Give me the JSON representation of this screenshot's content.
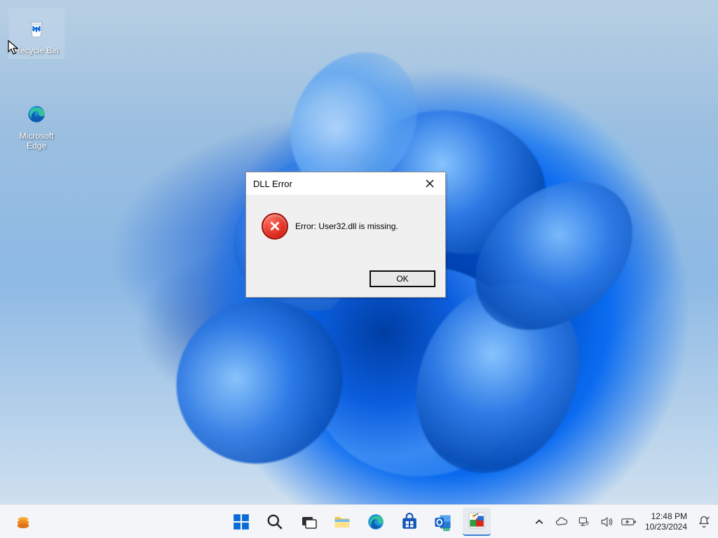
{
  "desktop_icons": {
    "recycle_bin": {
      "label": "Recycle Bin"
    },
    "edge": {
      "label": "Microsoft\nEdge"
    }
  },
  "dialog": {
    "title": "DLL Error",
    "message": "Error: User32.dll is missing.",
    "ok_label": "OK"
  },
  "taskbar": {
    "time": "12:48 PM",
    "date": "10/23/2024"
  }
}
